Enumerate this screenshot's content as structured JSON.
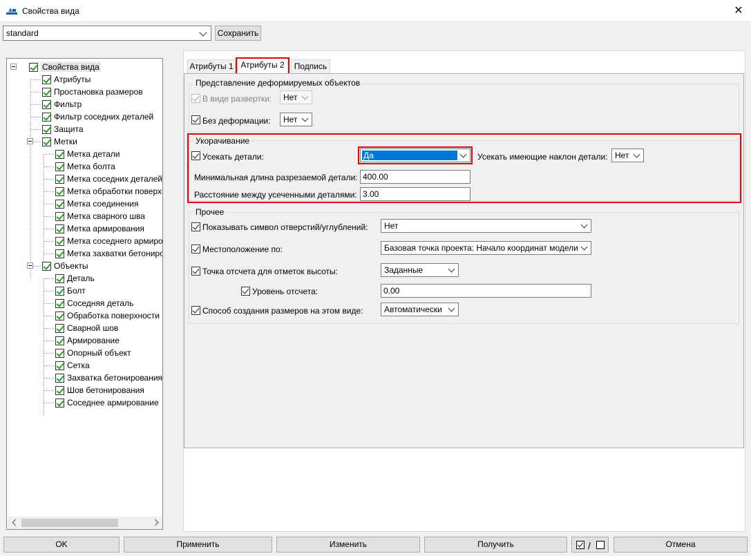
{
  "window": {
    "title": "Свойства вида",
    "close_symbol": "✕"
  },
  "preset": {
    "value": "standard",
    "save_label": "Сохранить"
  },
  "tree": {
    "root": "Свойства вида",
    "root_items": [
      "Атрибуты",
      "Простановка размеров",
      "Фильтр",
      "Фильтр соседних деталей",
      "Защита"
    ],
    "marks_label": "Метки",
    "marks": [
      "Метка детали",
      "Метка болта",
      "Метка соседних деталей",
      "Метка обработки поверхн",
      "Метка соединения",
      "Метка сварного шва",
      "Метка армирования",
      "Метка соседнего армиров",
      "Метка захватки бетониров"
    ],
    "objects_label": "Объекты",
    "objects": [
      "Деталь",
      "Болт",
      "Соседняя деталь",
      "Обработка поверхности",
      "Сварной шов",
      "Армирование",
      "Опорный объект",
      "Сетка",
      "Захватка бетонирования",
      "Шов бетонирования",
      "Соседнее армирование"
    ]
  },
  "tabs": [
    "Атрибуты 1",
    "Атрибуты 2",
    "Подпись"
  ],
  "deform": {
    "title": "Представление деформируемых объектов",
    "unfold_label": "В виде развертки:",
    "unfold_value": "Нет",
    "nodeform_label": "Без деформации:",
    "nodeform_value": "Нет"
  },
  "shortening": {
    "title": "Укорачивание",
    "cut_label": "Усекать детали:",
    "cut_value": "Да",
    "slope_label": "Усекать имеющие наклон детали:",
    "slope_value": "Нет",
    "minlen_label": "Минимальная длина разрезаемой детали:",
    "minlen_value": "400.00",
    "gap_label": "Расстояние между усеченными деталями:",
    "gap_value": "3.00"
  },
  "other": {
    "title": "Прочее",
    "holes_label": "Показывать символ отверстий/углублений:",
    "holes_value": "Нет",
    "location_label": "Местоположение по:",
    "location_value": "Базовая точка проекта: Начало координат модели",
    "elev_label": "Точка отсчета для отметок высоты:",
    "elev_value": "Заданные",
    "level_label": "Уровень отсчета:",
    "level_value": "0.00",
    "dim_label": "Способ создания размеров на этом виде:",
    "dim_value": "Автоматически"
  },
  "buttons": {
    "ok": "OK",
    "apply": "Применить",
    "modify": "Изменить",
    "get": "Получить",
    "cancel": "Отмена",
    "slash": "/"
  },
  "colors": {
    "highlight": "#e3000f",
    "selection": "#0078d7",
    "check_green": "#1fa21f"
  }
}
